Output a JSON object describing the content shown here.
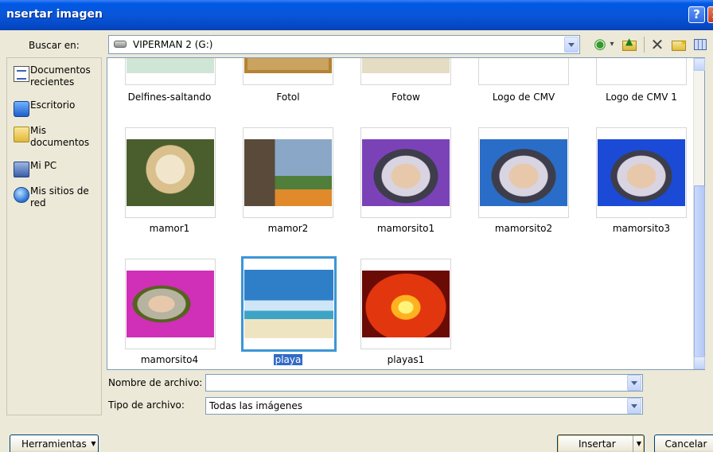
{
  "window": {
    "title": "nsertar imagen",
    "help_glyph": "?",
    "close_glyph": "×"
  },
  "lookin": {
    "label": "Buscar en:",
    "value": "VIPERMAN 2 (G:)"
  },
  "toolbar": {
    "back_glyph": "◉",
    "delete_glyph": "✕"
  },
  "places": [
    {
      "label": "Documentos recientes"
    },
    {
      "label": "Escritorio"
    },
    {
      "label": "Mis documentos"
    },
    {
      "label": "Mi PC"
    },
    {
      "label": "Mis sitios de red"
    }
  ],
  "files": [
    {
      "name": "Delfines-saltando"
    },
    {
      "name": "Fotol"
    },
    {
      "name": "Fotow"
    },
    {
      "name": "Logo de CMV"
    },
    {
      "name": "Logo de CMV 1"
    },
    {
      "name": "mamor1"
    },
    {
      "name": "mamor2"
    },
    {
      "name": "mamorsito1"
    },
    {
      "name": "mamorsito2"
    },
    {
      "name": "mamorsito3"
    },
    {
      "name": "mamorsito4"
    },
    {
      "name": "playa",
      "selected": true
    },
    {
      "name": "playas1"
    }
  ],
  "filename": {
    "label": "Nombre de archivo:",
    "value": ""
  },
  "filetype": {
    "label": "Tipo de archivo:",
    "value": "Todas las imágenes"
  },
  "buttons": {
    "tools": "Herramientas",
    "insert": "Insertar",
    "cancel": "Cancelar"
  },
  "colors": {
    "titlebar": "#0a56d8",
    "selection": "#316ac5",
    "selected_border": "#3d95d6"
  }
}
